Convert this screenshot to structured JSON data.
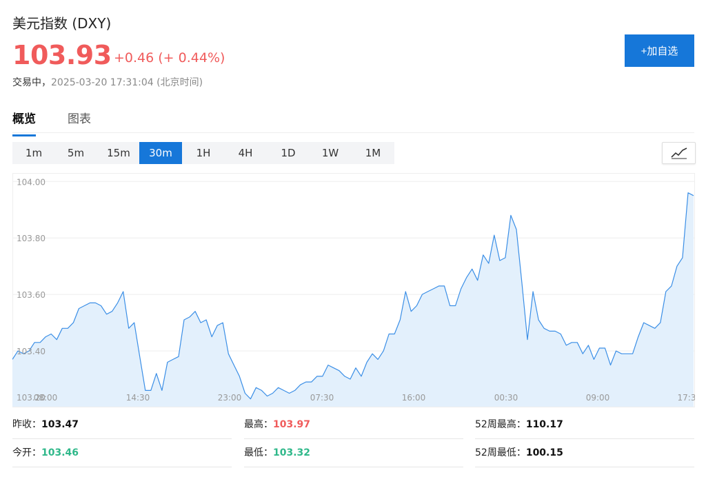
{
  "header": {
    "title": "美元指数 (DXY)",
    "price": "103.93",
    "change": "+0.46 (+ 0.44%)",
    "status_label": "交易中，",
    "timestamp": "2025-03-20 17:31:04 (北京时间)",
    "add_button": "+加自选"
  },
  "tabs": [
    {
      "label": "概览",
      "active": true
    },
    {
      "label": "图表",
      "active": false
    }
  ],
  "intervals": [
    {
      "label": "1m",
      "active": false
    },
    {
      "label": "5m",
      "active": false
    },
    {
      "label": "15m",
      "active": false
    },
    {
      "label": "30m",
      "active": true
    },
    {
      "label": "1H",
      "active": false
    },
    {
      "label": "4H",
      "active": false
    },
    {
      "label": "1D",
      "active": false
    },
    {
      "label": "1W",
      "active": false
    },
    {
      "label": "1M",
      "active": false
    }
  ],
  "chart_toggle_icon": "line-chart-icon",
  "colors": {
    "up": "#f05b5b",
    "down": "#2fb88a",
    "accent": "#1677d9",
    "line": "#3a8ee6",
    "area": "#e3f0fc"
  },
  "chart_data": {
    "type": "area",
    "title": "",
    "xlabel": "",
    "ylabel": "",
    "ylim": [
      103.2,
      104.03
    ],
    "y_ticks": [
      "103.20",
      "103.40",
      "103.60",
      "103.80",
      "104.00"
    ],
    "x_ticks": [
      "08:00",
      "14:30",
      "23:00",
      "07:30",
      "16:00",
      "00:30",
      "09:00",
      "17:3"
    ],
    "grid": true,
    "series": [
      {
        "values": [
          103.37,
          103.4,
          103.39,
          103.4,
          103.43,
          103.43,
          103.45,
          103.46,
          103.44,
          103.48,
          103.48,
          103.5,
          103.55,
          103.56,
          103.57,
          103.57,
          103.56,
          103.53,
          103.54,
          103.57,
          103.61,
          103.48,
          103.5,
          103.38,
          103.26,
          103.26,
          103.32,
          103.26,
          103.36,
          103.37,
          103.38,
          103.51,
          103.52,
          103.54,
          103.5,
          103.51,
          103.45,
          103.49,
          103.5,
          103.39,
          103.35,
          103.31,
          103.25,
          103.23,
          103.27,
          103.26,
          103.24,
          103.25,
          103.27,
          103.26,
          103.25,
          103.26,
          103.28,
          103.29,
          103.29,
          103.31,
          103.31,
          103.35,
          103.34,
          103.33,
          103.31,
          103.3,
          103.34,
          103.31,
          103.36,
          103.39,
          103.37,
          103.4,
          103.46,
          103.46,
          103.51,
          103.61,
          103.54,
          103.56,
          103.6,
          103.61,
          103.62,
          103.63,
          103.63,
          103.56,
          103.56,
          103.62,
          103.66,
          103.69,
          103.65,
          103.74,
          103.71,
          103.81,
          103.72,
          103.73,
          103.88,
          103.83,
          103.64,
          103.44,
          103.61,
          103.51,
          103.48,
          103.47,
          103.47,
          103.46,
          103.42,
          103.43,
          103.43,
          103.39,
          103.42,
          103.37,
          103.41,
          103.41,
          103.35,
          103.4,
          103.39,
          103.39,
          103.39,
          103.45,
          103.5,
          103.49,
          103.48,
          103.5,
          103.61,
          103.63,
          103.7,
          103.73,
          103.96,
          103.95
        ]
      }
    ]
  },
  "stats": {
    "prev_close_label": "昨收：",
    "prev_close": "103.47",
    "high_label": "最高：",
    "high": "103.97",
    "high52_label": "52周最高：",
    "high52": "110.17",
    "open_label": "今开：",
    "open": "103.46",
    "low_label": "最低：",
    "low": "103.32",
    "low52_label": "52周最低：",
    "low52": "100.15"
  }
}
